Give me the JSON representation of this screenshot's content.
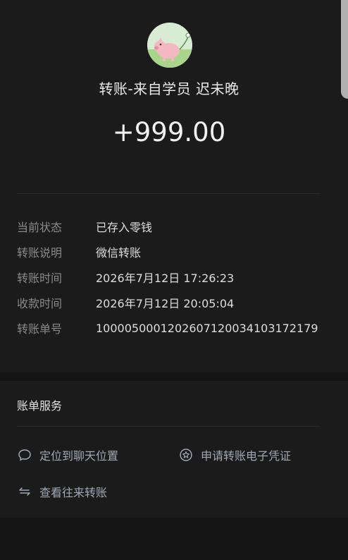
{
  "header": {
    "title": "转账-来自学员 迟未晚",
    "amount": "+999.00"
  },
  "details": [
    {
      "label": "当前状态",
      "value": "已存入零钱"
    },
    {
      "label": "转账说明",
      "value": "微信转账"
    },
    {
      "label": "转账时间",
      "value": "2026年7月12日 17:26:23"
    },
    {
      "label": "收款时间",
      "value": "2026年7月12日 20:05:04"
    },
    {
      "label": "转账单号",
      "value": "1000050001202607120034103172179"
    }
  ],
  "services": {
    "title": "账单服务",
    "locate_chat": "定位到聊天位置",
    "apply_receipt": "申请转账电子凭证",
    "view_history": "查看往来转账"
  },
  "colors": {
    "background": "#141414",
    "card": "#1b1b1b",
    "label": "#8a8a8a",
    "link": "#9fa7b5"
  },
  "icons": {
    "avatar": "pig-cartoon-avatar",
    "locate_chat": "chat-bubble-icon",
    "apply_receipt": "star-badge-icon",
    "view_history": "swap-arrows-icon"
  }
}
